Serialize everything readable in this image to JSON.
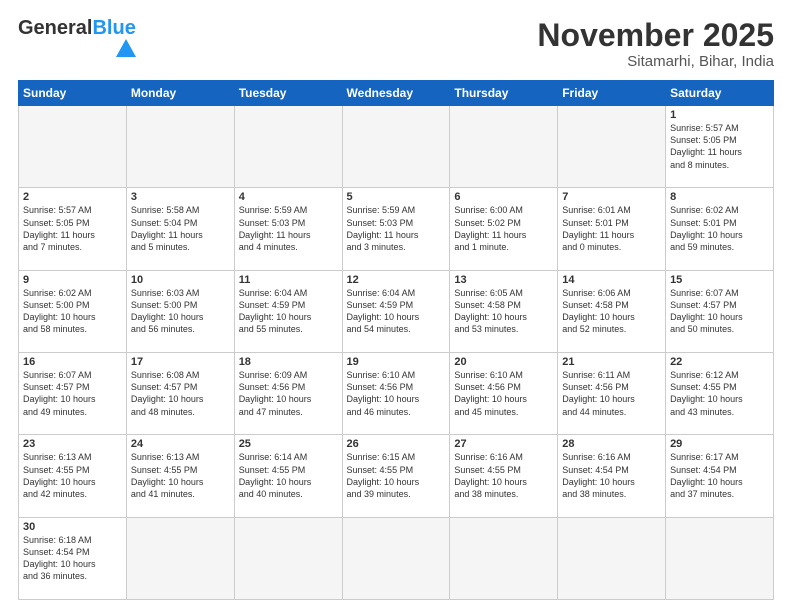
{
  "header": {
    "logo_general": "General",
    "logo_blue": "Blue",
    "title": "November 2025",
    "location": "Sitamarhi, Bihar, India"
  },
  "weekdays": [
    "Sunday",
    "Monday",
    "Tuesday",
    "Wednesday",
    "Thursday",
    "Friday",
    "Saturday"
  ],
  "weeks": [
    [
      {
        "day": "",
        "info": ""
      },
      {
        "day": "",
        "info": ""
      },
      {
        "day": "",
        "info": ""
      },
      {
        "day": "",
        "info": ""
      },
      {
        "day": "",
        "info": ""
      },
      {
        "day": "",
        "info": ""
      },
      {
        "day": "1",
        "info": "Sunrise: 5:57 AM\nSunset: 5:05 PM\nDaylight: 11 hours\nand 8 minutes."
      }
    ],
    [
      {
        "day": "2",
        "info": "Sunrise: 5:57 AM\nSunset: 5:05 PM\nDaylight: 11 hours\nand 7 minutes."
      },
      {
        "day": "3",
        "info": "Sunrise: 5:58 AM\nSunset: 5:04 PM\nDaylight: 11 hours\nand 5 minutes."
      },
      {
        "day": "4",
        "info": "Sunrise: 5:59 AM\nSunset: 5:03 PM\nDaylight: 11 hours\nand 4 minutes."
      },
      {
        "day": "5",
        "info": "Sunrise: 5:59 AM\nSunset: 5:03 PM\nDaylight: 11 hours\nand 3 minutes."
      },
      {
        "day": "6",
        "info": "Sunrise: 6:00 AM\nSunset: 5:02 PM\nDaylight: 11 hours\nand 1 minute."
      },
      {
        "day": "7",
        "info": "Sunrise: 6:01 AM\nSunset: 5:01 PM\nDaylight: 11 hours\nand 0 minutes."
      },
      {
        "day": "8",
        "info": "Sunrise: 6:02 AM\nSunset: 5:01 PM\nDaylight: 10 hours\nand 59 minutes."
      }
    ],
    [
      {
        "day": "9",
        "info": "Sunrise: 6:02 AM\nSunset: 5:00 PM\nDaylight: 10 hours\nand 58 minutes."
      },
      {
        "day": "10",
        "info": "Sunrise: 6:03 AM\nSunset: 5:00 PM\nDaylight: 10 hours\nand 56 minutes."
      },
      {
        "day": "11",
        "info": "Sunrise: 6:04 AM\nSunset: 4:59 PM\nDaylight: 10 hours\nand 55 minutes."
      },
      {
        "day": "12",
        "info": "Sunrise: 6:04 AM\nSunset: 4:59 PM\nDaylight: 10 hours\nand 54 minutes."
      },
      {
        "day": "13",
        "info": "Sunrise: 6:05 AM\nSunset: 4:58 PM\nDaylight: 10 hours\nand 53 minutes."
      },
      {
        "day": "14",
        "info": "Sunrise: 6:06 AM\nSunset: 4:58 PM\nDaylight: 10 hours\nand 52 minutes."
      },
      {
        "day": "15",
        "info": "Sunrise: 6:07 AM\nSunset: 4:57 PM\nDaylight: 10 hours\nand 50 minutes."
      }
    ],
    [
      {
        "day": "16",
        "info": "Sunrise: 6:07 AM\nSunset: 4:57 PM\nDaylight: 10 hours\nand 49 minutes."
      },
      {
        "day": "17",
        "info": "Sunrise: 6:08 AM\nSunset: 4:57 PM\nDaylight: 10 hours\nand 48 minutes."
      },
      {
        "day": "18",
        "info": "Sunrise: 6:09 AM\nSunset: 4:56 PM\nDaylight: 10 hours\nand 47 minutes."
      },
      {
        "day": "19",
        "info": "Sunrise: 6:10 AM\nSunset: 4:56 PM\nDaylight: 10 hours\nand 46 minutes."
      },
      {
        "day": "20",
        "info": "Sunrise: 6:10 AM\nSunset: 4:56 PM\nDaylight: 10 hours\nand 45 minutes."
      },
      {
        "day": "21",
        "info": "Sunrise: 6:11 AM\nSunset: 4:56 PM\nDaylight: 10 hours\nand 44 minutes."
      },
      {
        "day": "22",
        "info": "Sunrise: 6:12 AM\nSunset: 4:55 PM\nDaylight: 10 hours\nand 43 minutes."
      }
    ],
    [
      {
        "day": "23",
        "info": "Sunrise: 6:13 AM\nSunset: 4:55 PM\nDaylight: 10 hours\nand 42 minutes."
      },
      {
        "day": "24",
        "info": "Sunrise: 6:13 AM\nSunset: 4:55 PM\nDaylight: 10 hours\nand 41 minutes."
      },
      {
        "day": "25",
        "info": "Sunrise: 6:14 AM\nSunset: 4:55 PM\nDaylight: 10 hours\nand 40 minutes."
      },
      {
        "day": "26",
        "info": "Sunrise: 6:15 AM\nSunset: 4:55 PM\nDaylight: 10 hours\nand 39 minutes."
      },
      {
        "day": "27",
        "info": "Sunrise: 6:16 AM\nSunset: 4:55 PM\nDaylight: 10 hours\nand 38 minutes."
      },
      {
        "day": "28",
        "info": "Sunrise: 6:16 AM\nSunset: 4:54 PM\nDaylight: 10 hours\nand 38 minutes."
      },
      {
        "day": "29",
        "info": "Sunrise: 6:17 AM\nSunset: 4:54 PM\nDaylight: 10 hours\nand 37 minutes."
      }
    ],
    [
      {
        "day": "30",
        "info": "Sunrise: 6:18 AM\nSunset: 4:54 PM\nDaylight: 10 hours\nand 36 minutes."
      },
      {
        "day": "",
        "info": ""
      },
      {
        "day": "",
        "info": ""
      },
      {
        "day": "",
        "info": ""
      },
      {
        "day": "",
        "info": ""
      },
      {
        "day": "",
        "info": ""
      },
      {
        "day": "",
        "info": ""
      }
    ]
  ]
}
